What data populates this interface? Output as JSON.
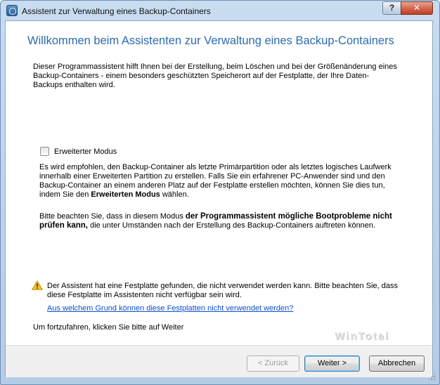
{
  "window": {
    "title": "Assistent zur Verwaltung eines Backup-Containers",
    "help_label": "?",
    "close_label": "✕"
  },
  "content": {
    "heading": "Willkommen beim Assistenten zur Verwaltung eines Backup-Containers",
    "intro": "Dieser Programmassistent hilft Ihnen bei der Erstellung, beim Löschen und bei der Größenänderung eines Backup-Containers - einem besonders geschützten Speicherort auf der Festplatte, der Ihre Daten-Backups enthalten wird.",
    "advanced_mode": {
      "label": "Erweiterter Modus",
      "checked": false
    },
    "advanced_p1_a": "Es wird empfohlen, den Backup-Container als letzte Primärpartition oder als letztes logisches Laufwerk innerhalb einer Erweiterten Partition zu erstellen. Falls Sie ein erfahrener PC-Anwender sind und den Backup-Container an einem anderen Platz auf der Festplatte erstellen möchten, können Sie dies tun, indem Sie den ",
    "advanced_p1_bold": "Erweiterten Modus",
    "advanced_p1_b": " wählen.",
    "advanced_p2_a": "Bitte beachten Sie, dass in diesem Modus ",
    "advanced_p2_bold": "der Programmassistent mögliche Bootprobleme nicht prüfen kann,",
    "advanced_p2_b": " die unter Umständen nach der Erstellung des Backup-Containers auftreten können.",
    "warning_text": "Der Assistent hat eine Festplatte gefunden, die nicht verwendet werden kann. Bitte beachten Sie, dass diese Festplatte im Assistenten nicht verfügbar sein wird.",
    "warning_link": "Aus welchem Grund können diese Festplatten nicht verwendet werden?",
    "continue_text": "Um fortzufahren, klicken Sie bitte auf Weiter",
    "watermark": "WinTotal"
  },
  "buttons": {
    "back": "< Zurück",
    "next": "Weiter >",
    "cancel": "Abbrechen"
  },
  "icons": {
    "app": "app-icon",
    "warning": "warning-icon",
    "warning_color": "#f3c21d"
  }
}
